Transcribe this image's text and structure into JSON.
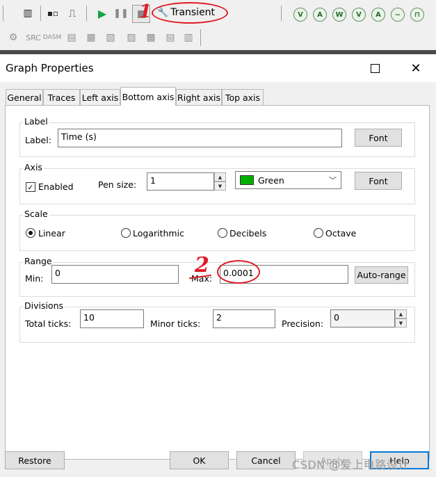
{
  "toolbar": {
    "transient_label": "Transient",
    "row2_labels": {
      "src": "SRC",
      "dasm": "DASM"
    },
    "accent_color": "#16a34a"
  },
  "annotations": {
    "mark_1": "1",
    "mark_2": "2",
    "color": "#e01b24"
  },
  "dialog": {
    "title": "Graph Properties",
    "tabs": [
      {
        "label": "General",
        "active": false
      },
      {
        "label": "Traces",
        "active": false
      },
      {
        "label": "Left axis",
        "active": false
      },
      {
        "label": "Bottom axis",
        "active": true
      },
      {
        "label": "Right axis",
        "active": false
      },
      {
        "label": "Top axis",
        "active": false
      }
    ],
    "label_group": {
      "title": "Label",
      "field_label": "Label:",
      "value": "Time (s)",
      "font_button": "Font"
    },
    "axis_group": {
      "title": "Axis",
      "enabled_label": "Enabled",
      "enabled_checked": true,
      "pen_size_label": "Pen size:",
      "pen_size_value": "1",
      "color_name": "Green",
      "color_hex": "#00b000",
      "font_button": "Font"
    },
    "scale_group": {
      "title": "Scale",
      "options": [
        {
          "label": "Linear",
          "checked": true
        },
        {
          "label": "Logarithmic",
          "checked": false
        },
        {
          "label": "Decibels",
          "checked": false
        },
        {
          "label": "Octave",
          "checked": false
        }
      ]
    },
    "range_group": {
      "title": "Range",
      "min_label": "Min:",
      "min_value": "0",
      "max_label": "Max:",
      "max_value": "0.0001",
      "auto_range_button": "Auto-range"
    },
    "divisions_group": {
      "title": "Divisions",
      "total_ticks_label": "Total ticks:",
      "total_ticks_value": "10",
      "minor_ticks_label": "Minor ticks:",
      "minor_ticks_value": "2",
      "precision_label": "Precision:",
      "precision_value": "0"
    },
    "footer": {
      "restore": "Restore",
      "ok": "OK",
      "cancel": "Cancel",
      "apply": "Apply",
      "help": "Help"
    }
  },
  "watermark": "CSDN @爱上电路设计"
}
